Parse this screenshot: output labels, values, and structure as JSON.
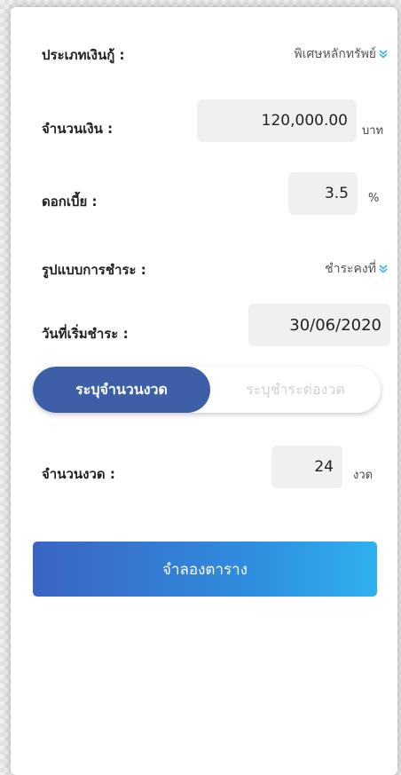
{
  "form": {
    "loan_type": {
      "label": "ประเภทเงินกู้ :",
      "value": "พิเศษหลักทรัพย์"
    },
    "amount": {
      "label": "จำนวนเงิน :",
      "value": "120,000.00",
      "unit": "บาท"
    },
    "interest": {
      "label": "ดอกเบี้ย :",
      "value": "3.5",
      "unit": "%"
    },
    "payment_type": {
      "label": "รูปแบบการชำระ :",
      "value": "ชำระคงที่"
    },
    "start_date": {
      "label": "วันที่เริ่มชำระ :",
      "value": "30/06/2020"
    },
    "mode_toggle": {
      "active": "ระบุจำนวนงวด",
      "inactive": "ระบุชำระต่องวด"
    },
    "installments": {
      "label": "จำนวนงวด :",
      "value": "24",
      "unit": "งวด"
    }
  },
  "actions": {
    "simulate_label": "จำลองตาราง"
  },
  "icons": {
    "dropdown": "chevron-double-down-icon"
  },
  "colors": {
    "toggle_active": "#3d5fa8",
    "button_start": "#3b64c4",
    "button_end": "#2fb0f0",
    "chevron": "#3ab4e6"
  }
}
